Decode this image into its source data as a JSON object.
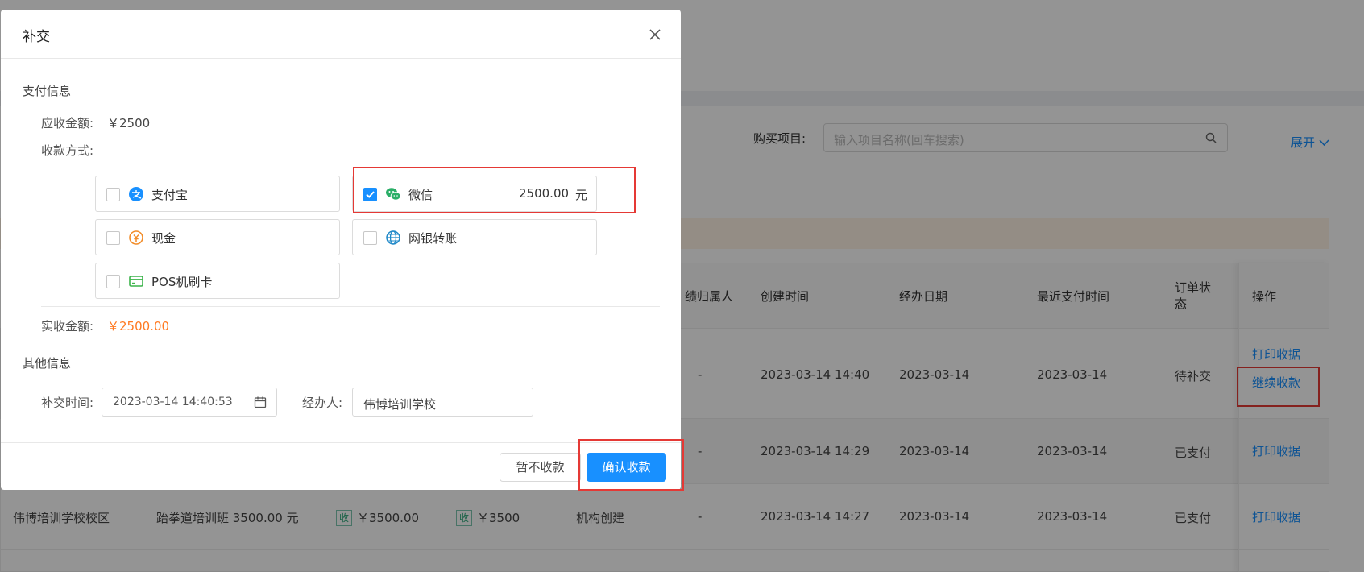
{
  "background": {
    "filter": {
      "label": "购买项目:",
      "placeholder": "输入项目名称(回车搜索)",
      "expand": "展开"
    },
    "table": {
      "headers": [
        "绩归属人",
        "创建时间",
        "经办日期",
        "最近支付时间",
        "订单状态",
        "操作"
      ],
      "rows": [
        {
          "owner": "-",
          "created": "2023-03-14 14:40",
          "handled": "2023-03-14",
          "last_paid": "2023-03-14",
          "status": "待补交",
          "actions": [
            "打印收据",
            "继续收款"
          ]
        },
        {
          "owner": "-",
          "created": "2023-03-14 14:29",
          "handled": "2023-03-14",
          "last_paid": "2023-03-14",
          "status": "已支付",
          "actions": [
            "打印收据"
          ]
        },
        {
          "campus": "伟博培训学校校区",
          "item": "跆拳道培训班 3500.00 元",
          "tag1": "收",
          "amount_receivable": "￥3500.00",
          "tag2": "收",
          "amount_received": "￥3500",
          "source": "机构创建",
          "owner": "-",
          "created": "2023-03-14 14:27",
          "handled": "2023-03-14",
          "last_paid": "2023-03-14",
          "status": "已支付",
          "actions": [
            "打印收据"
          ]
        }
      ]
    }
  },
  "modal": {
    "title": "补交",
    "payment_section": "支付信息",
    "receivable_label": "应收金额:",
    "receivable_value": "￥2500",
    "method_label": "收款方式:",
    "methods": [
      {
        "name": "支付宝",
        "icon": "alipay-icon",
        "checked": false
      },
      {
        "name": "微信",
        "icon": "wechat-icon",
        "checked": true,
        "amount": "2500.00",
        "unit": "元"
      },
      {
        "name": "现金",
        "icon": "cash-icon",
        "checked": false
      },
      {
        "name": "网银转账",
        "icon": "bank-transfer-icon",
        "checked": false
      },
      {
        "name": "POS机刷卡",
        "icon": "pos-card-icon",
        "checked": false
      }
    ],
    "actual_label": "实收金额:",
    "actual_value": "￥2500.00",
    "other_section": "其他信息",
    "time_label": "补交时间:",
    "time_value": "2023-03-14 14:40:53",
    "handler_label": "经办人:",
    "handler_value": "伟博培训学校",
    "cancel_button": "暂不收款",
    "confirm_button": "确认收款"
  },
  "colors": {
    "primary": "#1890ff",
    "amount": "#ff7a22",
    "highlight": "#e53935",
    "wechat": "#2aae67"
  }
}
